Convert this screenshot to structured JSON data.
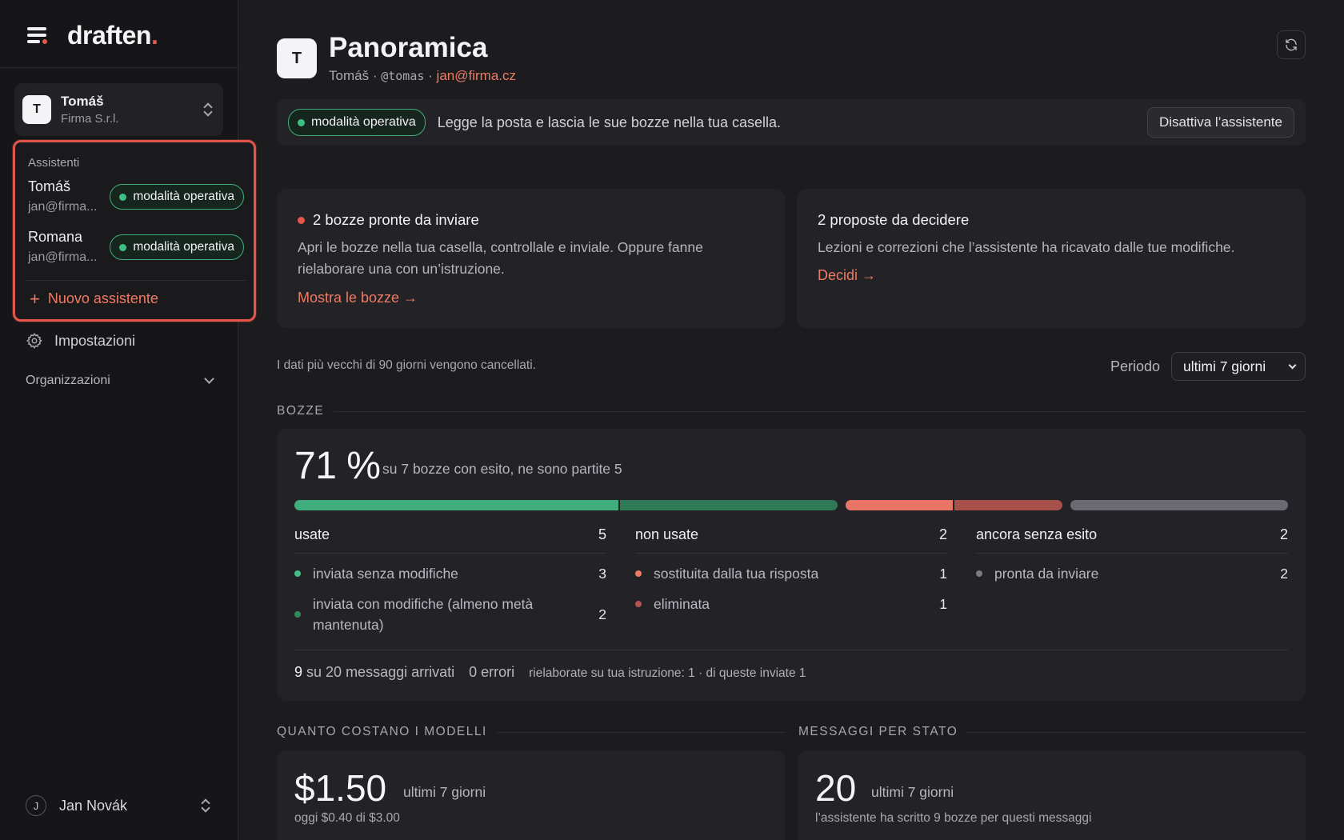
{
  "brand": {
    "name": "draften",
    "dot": "."
  },
  "sidebar": {
    "account": {
      "initial": "T",
      "name": "Tomáš",
      "org": "Firma S.r.l."
    },
    "assistants": {
      "heading": "Assistenti",
      "items": [
        {
          "name": "Tomáš",
          "email": "jan@firma...",
          "status": "modalità operativa"
        },
        {
          "name": "Romana",
          "email": "jan@firma...",
          "status": "modalità operativa"
        }
      ],
      "new_label": "Nuovo assistente"
    },
    "settings_label": "Impostazioni",
    "orgs_label": "Organizzazioni",
    "user": {
      "initial": "J",
      "name": "Jan Novák"
    }
  },
  "header": {
    "initial": "T",
    "title": "Panoramica",
    "sub_name": "Tomáš",
    "sep1": "·",
    "handle": "@tomas",
    "sep2": "·",
    "email": "jan@firma.cz"
  },
  "mode_bar": {
    "status": "modalità operativa",
    "text": "Legge la posta e lascia le sue bozze nella tua casella.",
    "button": "Disattiva l’assistente"
  },
  "cards": {
    "drafts_ready": {
      "title": "2 bozze pronte da inviare",
      "desc": "Apri le bozze nella tua casella, controllale e inviale. Oppure fanne rielaborare una con un’istruzione.",
      "link": "Mostra le bozze →"
    },
    "proposals": {
      "title": "2 proposte da decidere",
      "desc": "Lezioni e correzioni che l’assistente ha ricavato dalle tue modifiche.",
      "link": "Decidi →"
    }
  },
  "retention_note": "I dati più vecchi di 90 giorni vengono cancellati.",
  "period": {
    "label": "Periodo",
    "selected": "ultimi 7 giorni"
  },
  "drafts": {
    "section": "BOZZE",
    "percent": "71 %",
    "percent_value": 71,
    "summary": "su 7 bozze con esito, ne sono partite 5",
    "bars": [
      {
        "name": "inviata senza modifiche",
        "value": 3,
        "color": "#3fae7c"
      },
      {
        "name": "inviata con modifiche",
        "value": 2,
        "color": "#2f7a56"
      },
      {
        "name": "sostituita dalla tua risposta",
        "value": 1,
        "color": "#e87565"
      },
      {
        "name": "eliminata",
        "value": 1,
        "color": "#a8504a"
      },
      {
        "name": "pronta da inviare",
        "value": 2,
        "color": "#6a6a72"
      }
    ],
    "columns": [
      {
        "title": "usate",
        "total": "5",
        "rows": [
          {
            "label": "inviata senza modifiche",
            "count": "3",
            "color": "#3fbf85"
          },
          {
            "label": "inviata con modifiche (almeno metà mantenuta)",
            "count": "2",
            "color": "#2f8a5f"
          }
        ]
      },
      {
        "title": "non usate",
        "total": "2",
        "rows": [
          {
            "label": "sostituita dalla tua risposta",
            "count": "1",
            "color": "#ee7b64"
          },
          {
            "label": "eliminata",
            "count": "1",
            "color": "#b4564e"
          }
        ]
      },
      {
        "title": "ancora senza esito",
        "total": "2",
        "rows": [
          {
            "label": "pronta da inviare",
            "count": "2",
            "color": "#7a7a82"
          }
        ]
      }
    ],
    "footer": {
      "arrived_num": "9",
      "arrived_text": "su 20 messaggi arrivati",
      "errors": "0 errori",
      "reworked": "rielaborate su tua istruzione: 1 · di queste inviate 1"
    }
  },
  "costs": {
    "section": "QUANTO COSTANO I MODELLI",
    "amount": "$1.50",
    "period": "ultimi 7 giorni",
    "note": "oggi $0.40 di $3.00"
  },
  "messages": {
    "section": "MESSAGGI PER STATO",
    "count": "20",
    "period": "ultimi 7 giorni",
    "note": "l’assistente ha scritto 9 bozze per questi messaggi"
  }
}
